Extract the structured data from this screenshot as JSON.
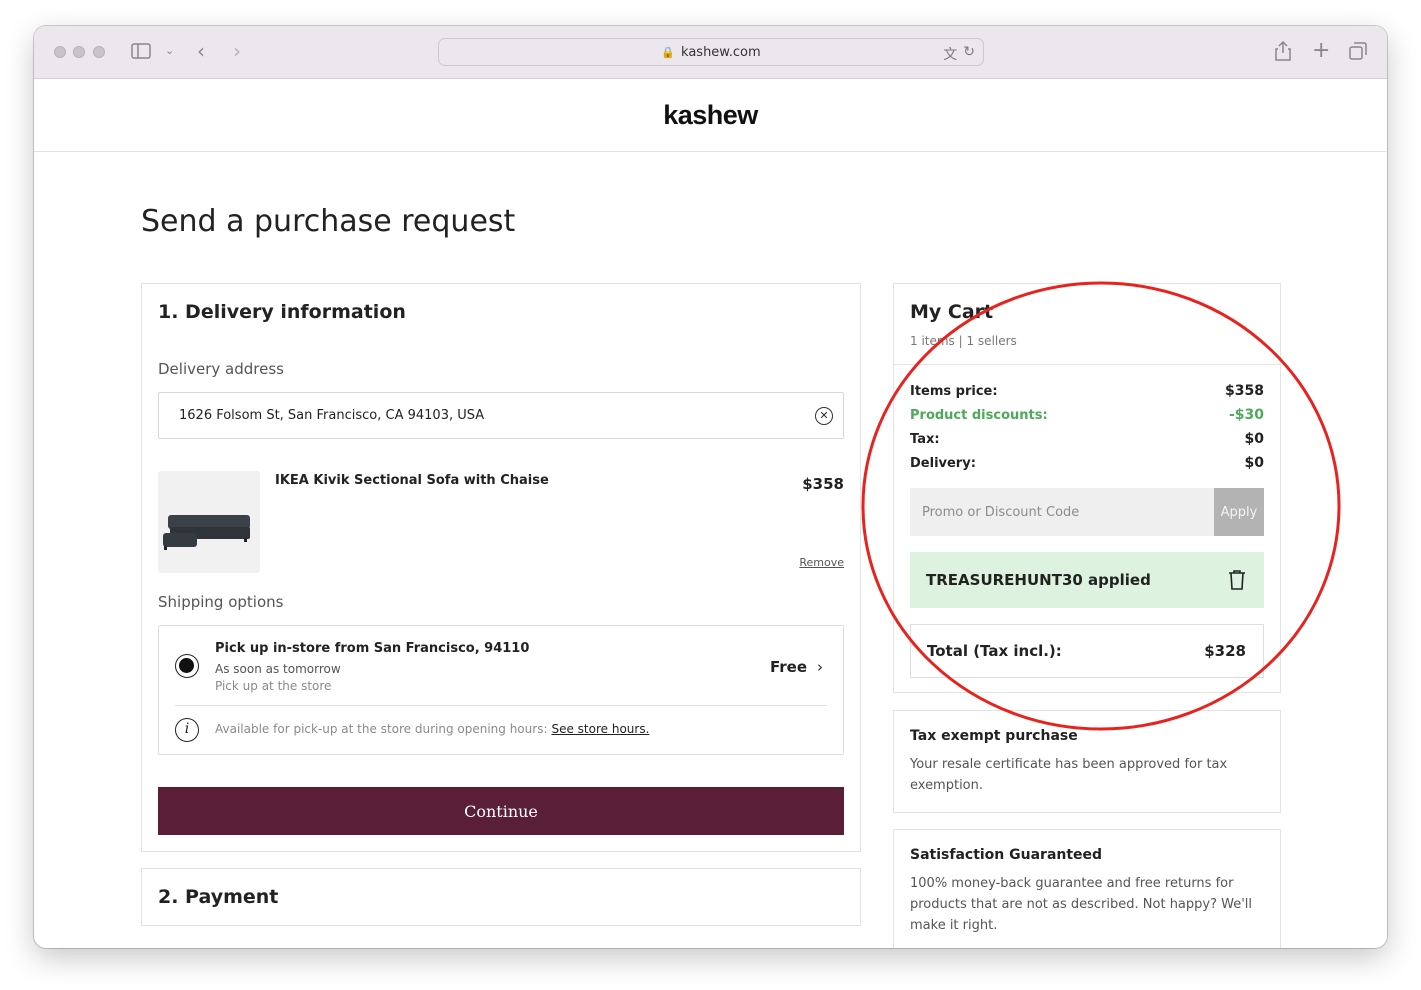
{
  "browser": {
    "url": "kashew.com"
  },
  "site": {
    "logo": "kashew"
  },
  "page": {
    "title": "Send a purchase request"
  },
  "delivery": {
    "section_title": "1. Delivery information",
    "address_label": "Delivery address",
    "address_value": "1626 Folsom St, San Francisco, CA 94103, USA",
    "product": {
      "name": "IKEA Kivik Sectional Sofa with Chaise",
      "price": "$358",
      "remove_label": "Remove"
    },
    "shipping_label": "Shipping options",
    "shipping_option": {
      "title": "Pick up in-store from San Francisco, 94110",
      "subtitle": "As soon as tomorrow",
      "detail": "Pick up at the store",
      "price": "Free",
      "selected": true
    },
    "pickup_info": "Available for pick-up at the store during opening hours:",
    "pickup_link": "See store hours.",
    "continue_label": "Continue"
  },
  "payment": {
    "section_title": "2. Payment"
  },
  "cart": {
    "title": "My Cart",
    "subtitle": "1 items | 1 sellers",
    "lines": [
      {
        "label": "Items price:",
        "value": "$358"
      },
      {
        "label": "Product discounts:",
        "value": "-$30"
      },
      {
        "label": "Tax:",
        "value": "$0"
      },
      {
        "label": "Delivery:",
        "value": "$0"
      }
    ],
    "promo_placeholder": "Promo or Discount Code",
    "apply_label": "Apply",
    "promo_applied": "TREASUREHUNT30 applied",
    "total_label": "Total (Tax incl.):",
    "total_value": "$328"
  },
  "tax_exempt": {
    "title": "Tax exempt purchase",
    "text": "Your resale certificate has been approved for tax exemption."
  },
  "guarantee": {
    "title": "Satisfaction Guaranteed",
    "text": "100% money-back guarantee and free returns for products that are not as described. Not happy? We'll make it right."
  },
  "colors": {
    "brand": "#5a1f37",
    "discount_green": "#4ea95a",
    "promo_applied_bg": "#ddf3df",
    "annotation_red": "#e8231e"
  },
  "icons": [
    "sidebar-icon",
    "back-icon",
    "forward-icon",
    "lock-icon",
    "translate-icon",
    "reload-icon",
    "share-icon",
    "new-tab-icon",
    "tabs-icon",
    "clear-icon",
    "info-icon",
    "chevron-right-icon",
    "trash-icon"
  ]
}
